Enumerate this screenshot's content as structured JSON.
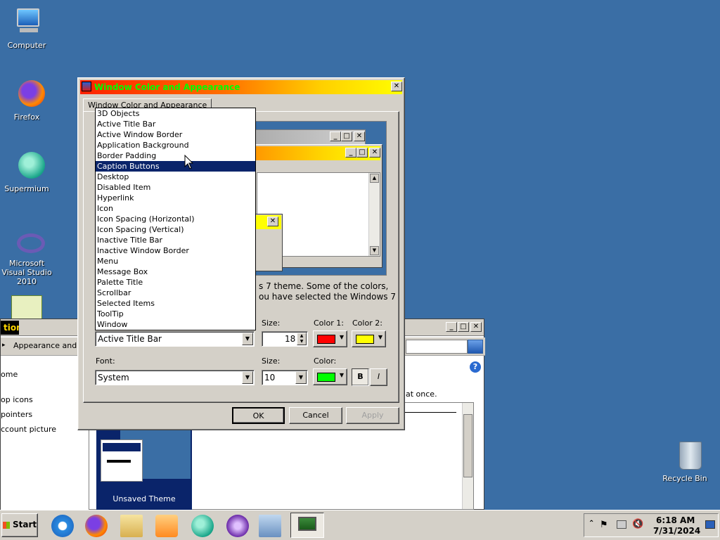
{
  "desktop": {
    "icons": [
      {
        "label": "Computer",
        "icon": "computer-icon"
      },
      {
        "label": "Firefox",
        "icon": "firefox-icon"
      },
      {
        "label": "Supermium",
        "icon": "supermium-icon"
      },
      {
        "label": "Microsoft Visual Studio 2010",
        "icon": "visual-studio-icon"
      },
      {
        "label": "Recycle Bin",
        "icon": "recycle-bin-icon"
      }
    ]
  },
  "background_window": {
    "title": "tion",
    "address": "Appearance and Pe",
    "side_links": [
      "ome",
      "op icons",
      "pointers",
      "ccount picture"
    ],
    "body_text": "at once.",
    "theme_label": "Unsaved Theme"
  },
  "dialog": {
    "title": "Window Color and Appearance",
    "tab": "Window Color and Appearance",
    "preview_text_1": "s 7 theme.  Some of the colors,",
    "preview_text_2": "ou have selected the Windows 7",
    "item_list": [
      "3D Objects",
      "Active Title Bar",
      "Active Window Border",
      "Application Background",
      "Border Padding",
      "Caption Buttons",
      "Desktop",
      "Disabled Item",
      "Hyperlink",
      "Icon",
      "Icon Spacing (Horizontal)",
      "Icon Spacing (Vertical)",
      "Inactive Title Bar",
      "Inactive Window Border",
      "Menu",
      "Message Box",
      "Palette Title",
      "Scrollbar",
      "Selected Items",
      "ToolTip",
      "Window"
    ],
    "highlighted_item": "Caption Buttons",
    "item_selected": "Active Title Bar",
    "size_label": "Size:",
    "item_size": "18",
    "color1_label": "Color 1:",
    "color2_label": "Color 2:",
    "color1": "#ff0000",
    "color2": "#ffff00",
    "font_label": "Font:",
    "font_value": "System",
    "font_size_label": "Size:",
    "font_size": "10",
    "font_color_label": "Color:",
    "font_color": "#00ff00",
    "bold_label": "B",
    "italic_label": "I",
    "ok": "OK",
    "cancel": "Cancel",
    "apply": "Apply"
  },
  "taskbar": {
    "start": "Start",
    "time": "6:18 AM",
    "date": "7/31/2024"
  }
}
